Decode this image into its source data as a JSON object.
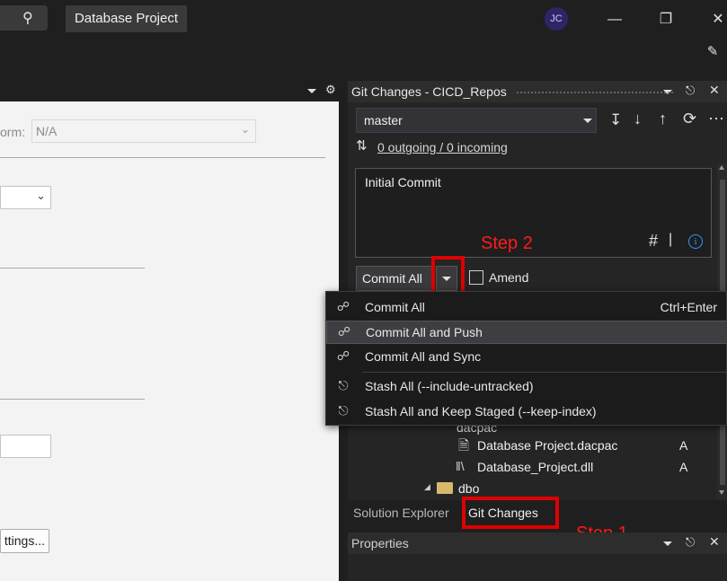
{
  "titlebar": {
    "search_icon": "search-icon",
    "project_name": "Database Project",
    "avatar_initials": "JC"
  },
  "left_doc": {
    "platform_label": "orm:",
    "platform_value": "N/A",
    "settings_button": "ttings..."
  },
  "git_panel": {
    "title": "Git Changes - CICD_Repos",
    "branch": "master",
    "sync_status": "0 outgoing / 0 incoming",
    "commit_message": "Initial Commit",
    "commit_button": "Commit All",
    "amend_label": "Amend"
  },
  "annotations": {
    "step1": "Step 1",
    "step2": "Step 2"
  },
  "commit_menu": {
    "items": [
      {
        "label": "Commit All",
        "shortcut": "Ctrl+Enter"
      },
      {
        "label": "Commit All and Push",
        "shortcut": ""
      },
      {
        "label": "Commit All and Sync",
        "shortcut": ""
      },
      {
        "label": "Stash All (--include-untracked)",
        "shortcut": ""
      },
      {
        "label": "Stash All and Keep Staged (--keep-index)",
        "shortcut": ""
      }
    ]
  },
  "tree": {
    "partial_folder": "dacpac",
    "files": [
      {
        "name": "Database Project.dacpac",
        "status": "A"
      },
      {
        "name": "Database_Project.dll",
        "status": "A"
      }
    ],
    "folder": "dbo"
  },
  "tabs": {
    "solution_explorer": "Solution Explorer",
    "git_changes": "Git Changes"
  },
  "properties": {
    "title": "Properties"
  },
  "colors": {
    "accent_red": "#e00000",
    "link_blue": "#3794ff"
  }
}
